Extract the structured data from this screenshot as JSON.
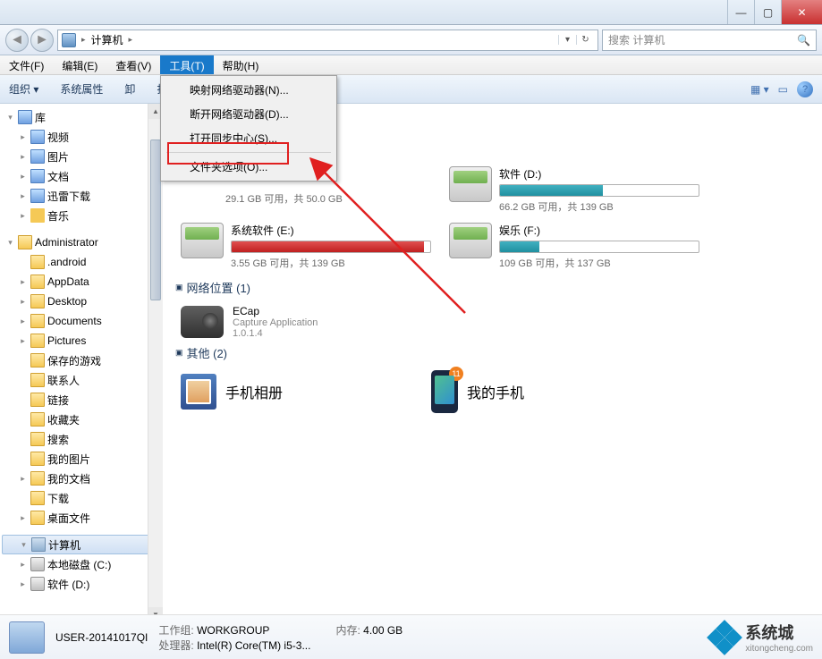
{
  "window": {
    "min": "—",
    "max": "▢",
    "close": "✕"
  },
  "nav": {
    "address_seg": "计算机",
    "search_placeholder": "搜索 计算机"
  },
  "menu": {
    "file": "文件(F)",
    "edit": "编辑(E)",
    "view": "查看(V)",
    "tools": "工具(T)",
    "help": "帮助(H)"
  },
  "dropdown": {
    "item0": "映射网络驱动器(N)...",
    "item1": "断开网络驱动器(D)...",
    "item2": "打开同步中心(S)...",
    "item3": "文件夹选项(O)..."
  },
  "toolbar": {
    "organize": "组织",
    "sys_props": "系统属性",
    "uninstall": "卸",
    "control_panel": "打开控制面板"
  },
  "tree": {
    "lib": "库",
    "videos": "视频",
    "pictures": "图片",
    "docs": "文档",
    "xunlei": "迅雷下载",
    "music": "音乐",
    "admin": "Administrator",
    "android": ".android",
    "appdata": "AppData",
    "desktop": "Desktop",
    "documents": "Documents",
    "pictures2": "Pictures",
    "savedgames": "保存的游戏",
    "contacts": "联系人",
    "links": "链接",
    "favorites": "收藏夹",
    "search": "搜索",
    "mypics": "我的图片",
    "mydocs": "我的文档",
    "downloads": "下载",
    "deskfiles": "桌面文件",
    "computer": "计算机",
    "drive_c": "本地磁盘 (C:)",
    "drive_d": "软件 (D:)"
  },
  "content": {
    "drive_c_free": "29.1 GB 可用，共 50.0 GB",
    "drive_d_name": "软件 (D:)",
    "drive_d_free": "66.2 GB 可用，共 139 GB",
    "drive_e_name": "系统软件 (E:)",
    "drive_e_free": "3.55 GB 可用，共 139 GB",
    "drive_f_name": "娱乐 (F:)",
    "drive_f_free": "109 GB 可用，共 137 GB",
    "group_net": "网络位置 (1)",
    "ecap_name": "ECap",
    "ecap_sub1": "Capture Application",
    "ecap_sub2": "1.0.1.4",
    "group_other": "其他 (2)",
    "album": "手机相册",
    "phone": "我的手机",
    "phone_badge": "11"
  },
  "status": {
    "pcname": "USER-20141017QI",
    "wg_label": "工作组:",
    "wg_val": "WORKGROUP",
    "mem_label": "内存:",
    "mem_val": "4.00 GB",
    "cpu_label": "处理器:",
    "cpu_val": "Intel(R) Core(TM) i5-3..."
  },
  "watermark": {
    "brand": "系统城",
    "url": "xitongcheng.com"
  }
}
